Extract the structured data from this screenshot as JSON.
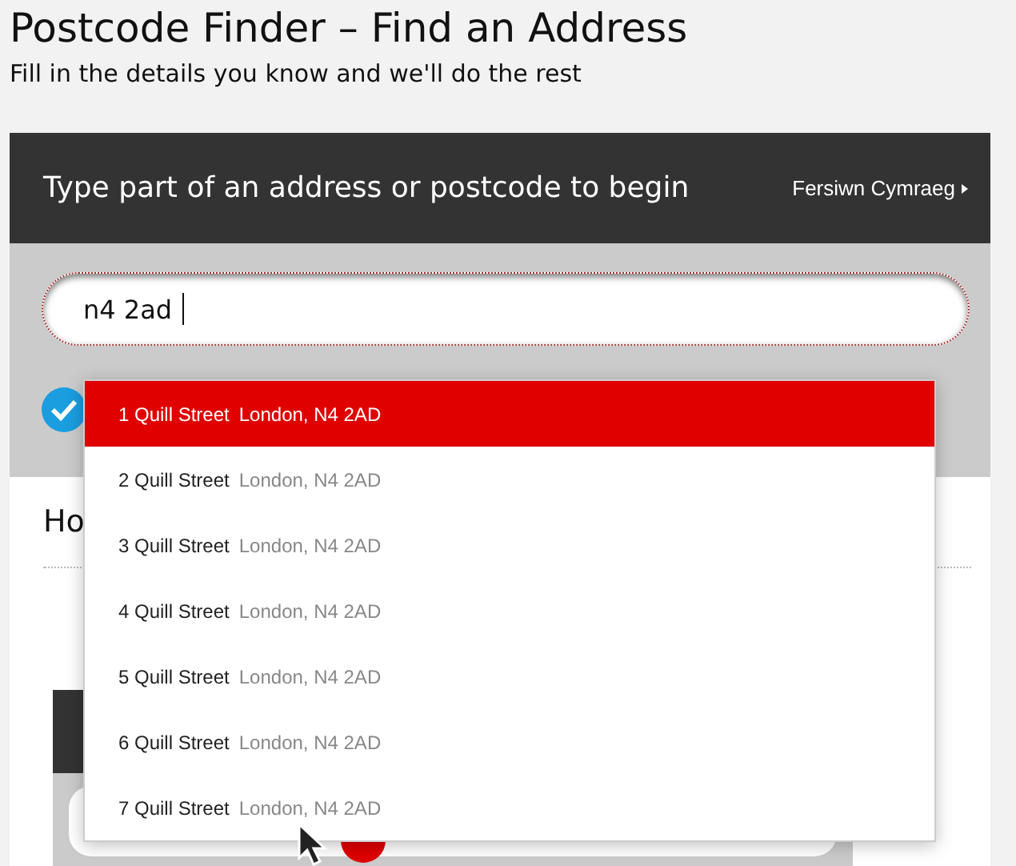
{
  "page": {
    "title": "Postcode Finder – Find an Address",
    "subtitle": "Fill in the details you know and we'll do the rest"
  },
  "panel": {
    "heading": "Type part of an address or postcode to begin",
    "language_link": "Fersiwn Cymraeg"
  },
  "search": {
    "value": "n4 2ad"
  },
  "suggestions": [
    {
      "street": "1 Quill Street",
      "locality": "London, N4 2AD",
      "selected": true
    },
    {
      "street": "2 Quill Street",
      "locality": "London, N4 2AD",
      "selected": false
    },
    {
      "street": "3 Quill Street",
      "locality": "London, N4 2AD",
      "selected": false
    },
    {
      "street": "4 Quill Street",
      "locality": "London, N4 2AD",
      "selected": false
    },
    {
      "street": "5 Quill Street",
      "locality": "London, N4 2AD",
      "selected": false
    },
    {
      "street": "6 Quill Street",
      "locality": "London, N4 2AD",
      "selected": false
    },
    {
      "street": "7 Quill Street",
      "locality": "London, N4 2AD",
      "selected": false
    }
  ],
  "section": {
    "heading": "Ho"
  }
}
